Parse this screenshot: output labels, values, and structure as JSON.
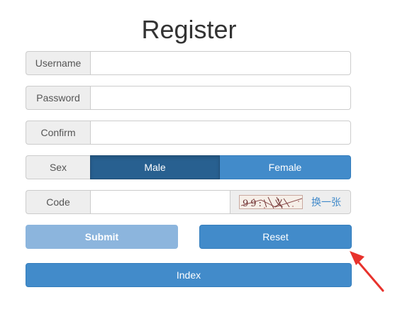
{
  "page": {
    "title": "Register"
  },
  "form": {
    "username": {
      "label": "Username",
      "value": ""
    },
    "password": {
      "label": "Password",
      "value": ""
    },
    "confirm": {
      "label": "Confirm",
      "value": ""
    },
    "sex": {
      "label": "Sex",
      "options": [
        "Male",
        "Female"
      ],
      "selected": "Male"
    },
    "code": {
      "label": "Code",
      "value": "",
      "captcha_text": "99:\\ 义",
      "change_label": "换一张"
    }
  },
  "buttons": {
    "submit_label": "Submit",
    "reset_label": "Reset",
    "index_label": "Index"
  },
  "colors": {
    "primary": "#428bca",
    "primary_active": "#286090",
    "disabled": "#8cb5dd",
    "annotation_arrow": "#e8322c"
  }
}
